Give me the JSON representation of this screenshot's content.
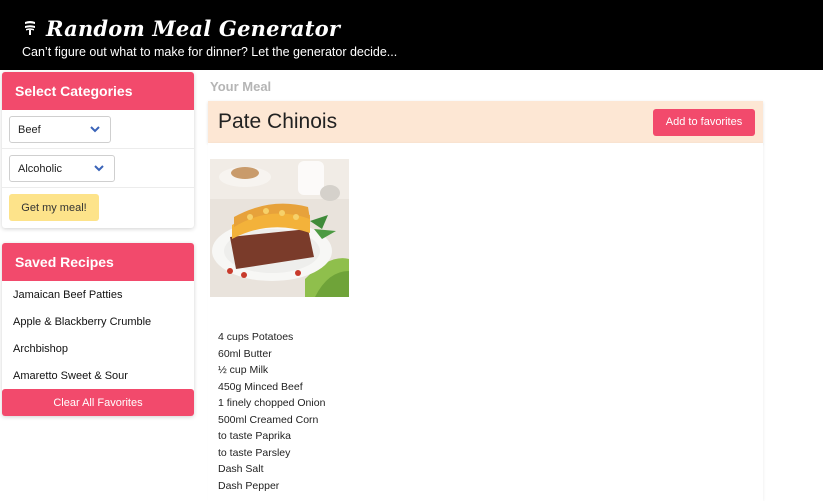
{
  "header": {
    "title": "Random Meal Generator",
    "subtitle": "Can’t figure out what to make for dinner? Let the generator decide...",
    "icon": "utensils-icon"
  },
  "categories": {
    "heading": "Select Categories",
    "category_select": {
      "value": "Beef"
    },
    "drink_select": {
      "value": "Alcoholic"
    },
    "submit_label": "Get my meal!"
  },
  "saved": {
    "heading": "Saved Recipes",
    "items": [
      {
        "label": "Jamaican Beef Patties"
      },
      {
        "label": "Apple & Blackberry Crumble"
      },
      {
        "label": "Archbishop"
      },
      {
        "label": "Amaretto Sweet & Sour"
      }
    ],
    "clear_label": "Clear All Favorites"
  },
  "meal": {
    "section_label": "Your Meal",
    "name": "Pate Chinois",
    "favorite_label": "Add to favorites",
    "ingredients": [
      "4 cups Potatoes",
      "60ml Butter",
      "½ cup Milk",
      "450g Minced Beef",
      "1 finely chopped Onion",
      "500ml Creamed Corn",
      "to taste Paprika",
      "to taste Parsley",
      "Dash Salt",
      "Dash Pepper"
    ]
  },
  "colors": {
    "accent": "#f24a6c",
    "button_yellow": "#fde38a",
    "meal_header_bg": "#fde7d4",
    "header_bg": "#000000"
  }
}
